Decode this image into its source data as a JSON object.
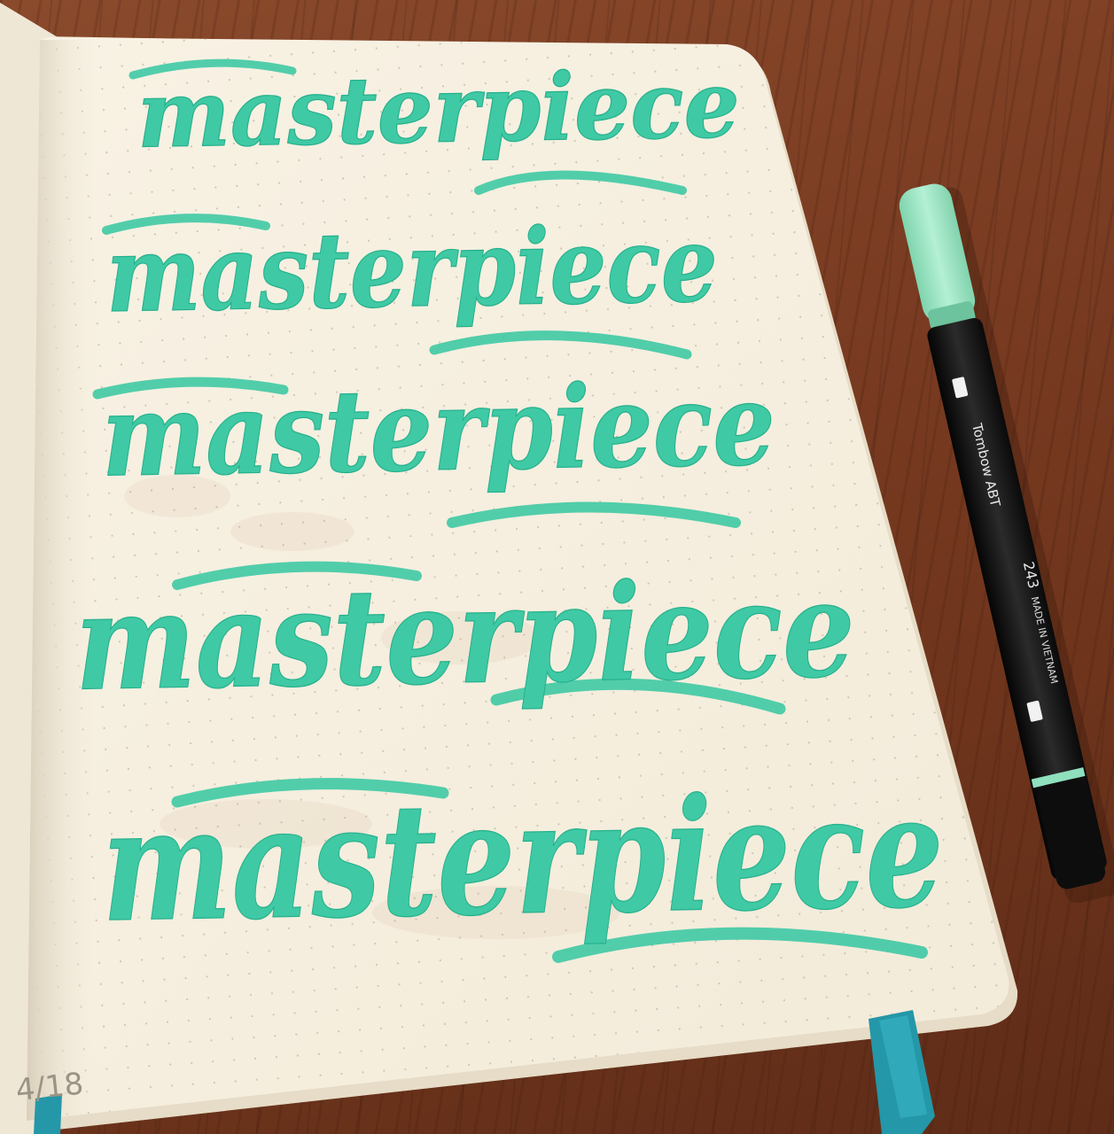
{
  "photo": {
    "subject": "hand-lettered practice page in a dot-grid notebook with a brush pen",
    "colors": {
      "desk": "#7a3c22",
      "paper": "#f7f1e3",
      "ink": "#3fc9a4",
      "ink_dark": "#1fa886",
      "pen_body": "#161616",
      "pen_cap": "#9fe6c6",
      "bookmark": "#2aa3b3"
    }
  },
  "lettering": {
    "words": [
      {
        "text": "masterpiece"
      },
      {
        "text": "masterpiece"
      },
      {
        "text": "masterpiece"
      },
      {
        "text": "masterpiece"
      },
      {
        "text": "masterpiece"
      }
    ]
  },
  "page": {
    "date_mark": "4/18"
  },
  "pen": {
    "brand_text": "Tombow ABT",
    "code_text": "243",
    "origin_text": "MADE IN VIETNAM"
  }
}
